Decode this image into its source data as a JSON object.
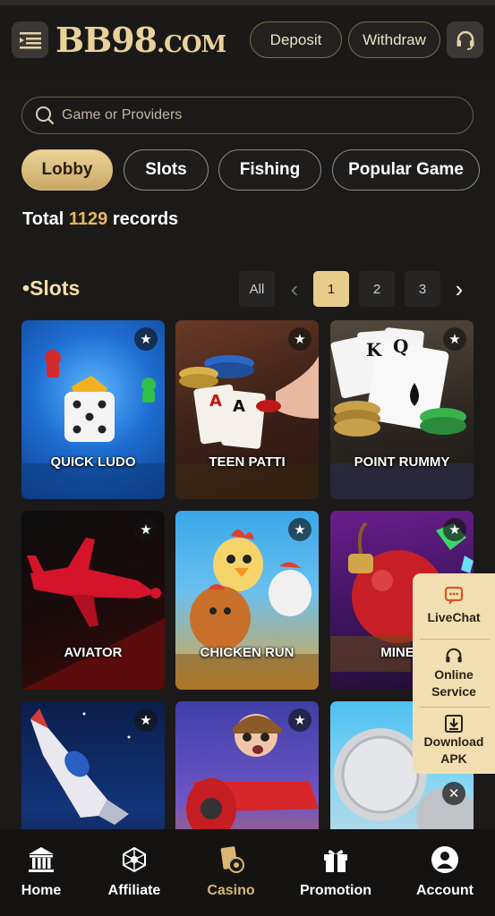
{
  "header": {
    "logo_main": "BB98",
    "logo_suffix": ".COM",
    "deposit_label": "Deposit",
    "withdraw_label": "Withdraw"
  },
  "search": {
    "placeholder": "Game or Providers"
  },
  "tabs": [
    {
      "label": "Lobby",
      "active": true
    },
    {
      "label": "Slots",
      "active": false
    },
    {
      "label": "Fishing",
      "active": false
    },
    {
      "label": "Popular Game",
      "active": false
    }
  ],
  "summary": {
    "prefix": "Total",
    "count": "1129",
    "suffix": "records"
  },
  "section": {
    "title": "Slots",
    "bullet": "•"
  },
  "pagination": {
    "all_label": "All",
    "pages": [
      "1",
      "2",
      "3"
    ],
    "current": "1"
  },
  "games": [
    {
      "title": "QUICK LUDO"
    },
    {
      "title": "TEEN PATTI"
    },
    {
      "title": "POINT RUMMY"
    },
    {
      "title": "AVIATOR"
    },
    {
      "title": "CHICKEN RUN"
    },
    {
      "title": "MINES"
    },
    {
      "title": ""
    },
    {
      "title": ""
    },
    {
      "title": ""
    }
  ],
  "side_menu": {
    "livechat": "LiveChat",
    "online_service_line1": "Online",
    "online_service_line2": "Service",
    "download_line1": "Download",
    "download_line2": "APK"
  },
  "bottom_nav": [
    {
      "label": "Home",
      "icon": "bank-icon"
    },
    {
      "label": "Affiliate",
      "icon": "network-icon"
    },
    {
      "label": "Casino",
      "icon": "cards-chip-icon",
      "active": true
    },
    {
      "label": "Promotion",
      "icon": "gift-icon"
    },
    {
      "label": "Account",
      "icon": "user-icon"
    }
  ],
  "colors": {
    "background": "#1c1a18",
    "accent_gold": "#e7cc8c",
    "count_highlight": "#e5b95b",
    "active_nav": "#d8b870",
    "side_menu_bg": "#f1dfb2"
  }
}
